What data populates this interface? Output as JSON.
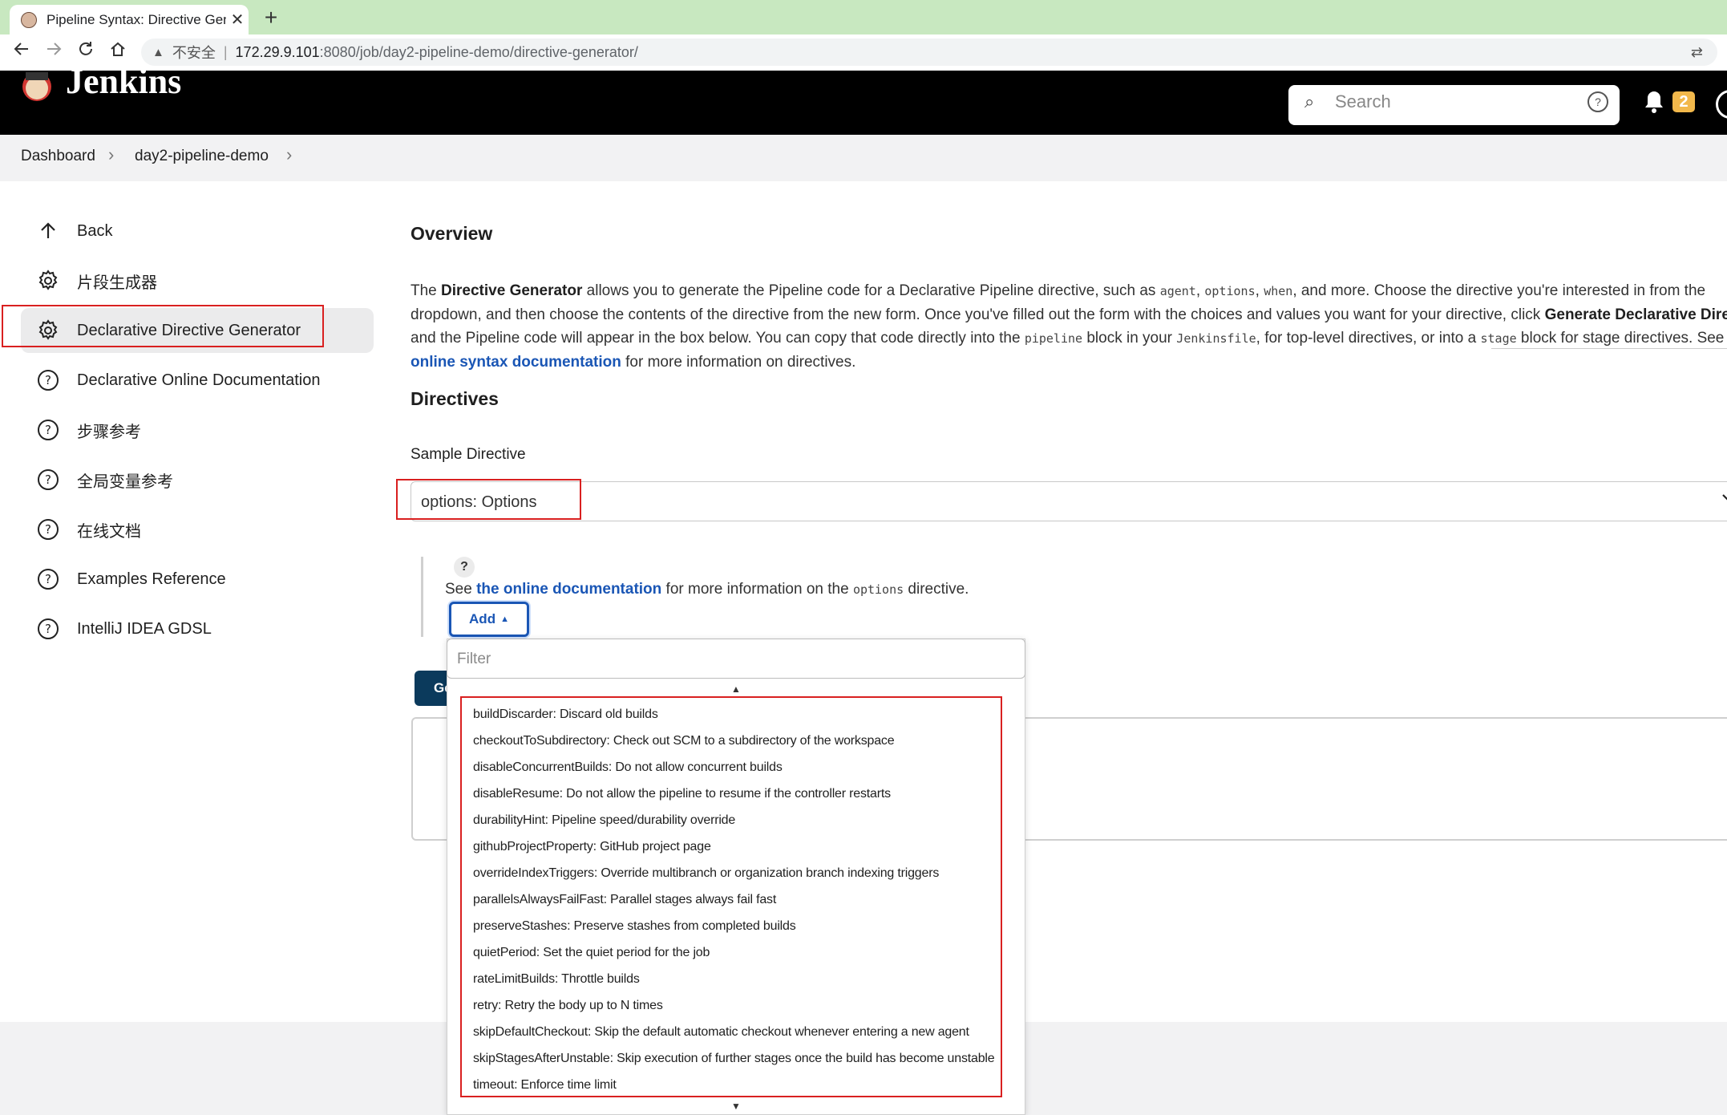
{
  "browser": {
    "tab_title": "Pipeline Syntax: Directive Gene",
    "close_glyph": "✕",
    "new_tab_glyph": "+",
    "insecure_label": "不安全",
    "url_host": "172.29.9.101",
    "url_path": ":8080/job/day2-pipeline-demo/directive-generator/"
  },
  "header": {
    "app_name": "Jenkins",
    "search_placeholder": "Search",
    "notification_count": "2"
  },
  "breadcrumb": {
    "items": [
      "Dashboard",
      "day2-pipeline-demo"
    ]
  },
  "sidebar": {
    "items": [
      {
        "label": "Back",
        "icon": "arrow-up-icon"
      },
      {
        "label": "片段生成器",
        "icon": "gear-icon"
      },
      {
        "label": "Declarative Directive Generator",
        "icon": "gear-icon"
      },
      {
        "label": "Declarative Online Documentation",
        "icon": "help-icon"
      },
      {
        "label": "步骤参考",
        "icon": "help-icon"
      },
      {
        "label": "全局变量参考",
        "icon": "help-icon"
      },
      {
        "label": "在线文档",
        "icon": "help-icon"
      },
      {
        "label": "Examples Reference",
        "icon": "help-icon"
      },
      {
        "label": "IntelliJ IDEA GDSL",
        "icon": "help-icon"
      }
    ]
  },
  "main": {
    "overview_heading": "Overview",
    "overview_text": {
      "p1": "The ",
      "b1": "Directive Generator",
      "p2": " allows you to generate the Pipeline code for a Declarative Pipeline directive, such as ",
      "c1": "agent",
      "p3": ", ",
      "c2": "options",
      "p4": ", ",
      "c3": "when",
      "p5": ", and more. Choose the directive you're interested in from the dropdown, and then choose the contents of the directive from the new form. Once you've filled out the form with the choices and values you want for your directive, click ",
      "b2": "Generate Declarative Directive",
      "p6": " and the Pipeline code will appear in the box below. You can copy that code directly into the ",
      "c4": "pipeline",
      "p7": " block in your ",
      "c5": "Jenkinsfile",
      "p8": ", for top-level directives, or into a ",
      "c6": "stage",
      "p9": " block for stage directives. See ",
      "link": "the online syntax documentation",
      "p10": " for more information on directives."
    },
    "directives_heading": "Directives",
    "sample_label": "Sample Directive",
    "sample_value": "options: Options",
    "help_glyph": "?",
    "note_see": "See ",
    "note_link": "the online documentation",
    "note_mid": " for more information on the ",
    "note_code": "options",
    "note_end": " directive.",
    "add_label": "Add",
    "generate_label": "Ge",
    "filter_placeholder": "Filter",
    "options": [
      "buildDiscarder: Discard old builds",
      "checkoutToSubdirectory: Check out SCM to a subdirectory of the workspace",
      "disableConcurrentBuilds: Do not allow concurrent builds",
      "disableResume: Do not allow the pipeline to resume if the controller restarts",
      "durabilityHint: Pipeline speed/durability override",
      "githubProjectProperty: GitHub project page",
      "overrideIndexTriggers: Override multibranch or organization branch indexing triggers",
      "parallelsAlwaysFailFast: Parallel stages always fail fast",
      "preserveStashes: Preserve stashes from completed builds",
      "quietPeriod: Set the quiet period for the job",
      "rateLimitBuilds: Throttle builds",
      "retry: Retry the body up to N times",
      "skipDefaultCheckout: Skip the default automatic checkout whenever entering a new agent",
      "skipStagesAfterUnstable: Skip execution of further stages once the build has become unstable",
      "timeout: Enforce time limit"
    ]
  },
  "colors": {
    "accent": "#1a56b5",
    "highlight_box": "#d92020",
    "header_bg": "#000000",
    "tabstrip_bg": "#c8e8c0"
  }
}
